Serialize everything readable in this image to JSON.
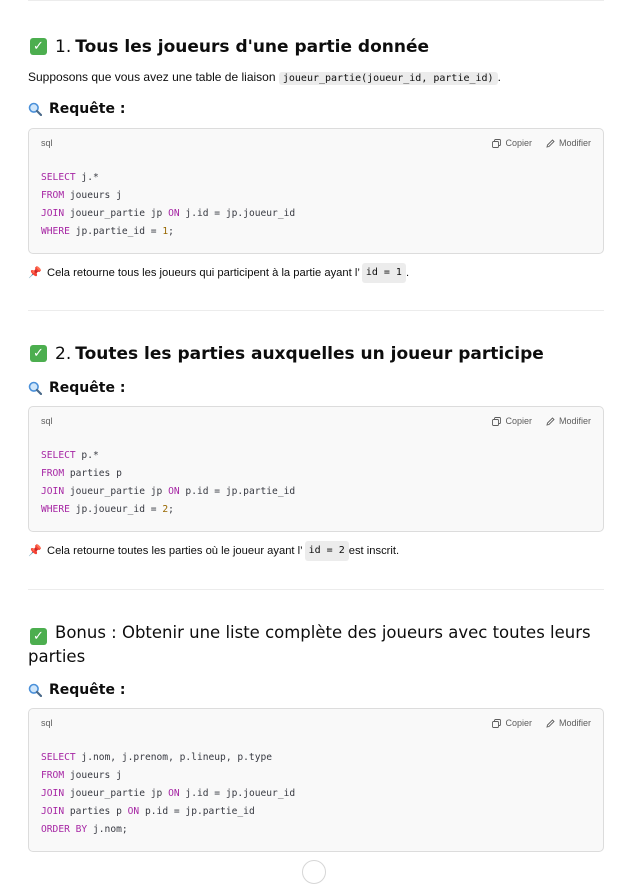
{
  "section1": {
    "number": "1.",
    "title": "Tous les joueurs d'une partie donnée",
    "intro_text": "Supposons que vous avez une table de liaison ",
    "intro_code": "joueur_partie(joueur_id, partie_id)",
    "intro_end": ".",
    "query_heading": "Requête :",
    "code_lang": "sql",
    "copy_label": "Copier",
    "edit_label": "Modifier",
    "code_lines": [
      [
        {
          "t": "SELECT",
          "k": "kw"
        },
        {
          "t": " j.*"
        }
      ],
      [
        {
          "t": "FROM",
          "k": "kw"
        },
        {
          "t": " joueurs j"
        }
      ],
      [
        {
          "t": "JOIN",
          "k": "kw"
        },
        {
          "t": " joueur_partie jp "
        },
        {
          "t": "ON",
          "k": "kw"
        },
        {
          "t": " j.id = jp.joueur_id"
        }
      ],
      [
        {
          "t": "WHERE",
          "k": "kw"
        },
        {
          "t": " jp.partie_id = "
        },
        {
          "t": "1",
          "k": "numlit"
        },
        {
          "t": ";"
        }
      ]
    ],
    "note_text": "Cela retourne tous les joueurs qui participent à la partie ayant l’",
    "note_code": "id = 1",
    "note_end": "."
  },
  "section2": {
    "number": "2.",
    "title": "Toutes les parties auxquelles un joueur participe",
    "query_heading": "Requête :",
    "code_lang": "sql",
    "copy_label": "Copier",
    "edit_label": "Modifier",
    "code_lines": [
      [
        {
          "t": "SELECT",
          "k": "kw"
        },
        {
          "t": " p.*"
        }
      ],
      [
        {
          "t": "FROM",
          "k": "kw"
        },
        {
          "t": " parties p"
        }
      ],
      [
        {
          "t": "JOIN",
          "k": "kw"
        },
        {
          "t": " joueur_partie jp "
        },
        {
          "t": "ON",
          "k": "kw"
        },
        {
          "t": " p.id = jp.partie_id"
        }
      ],
      [
        {
          "t": "WHERE",
          "k": "kw"
        },
        {
          "t": " jp.joueur_id = "
        },
        {
          "t": "2",
          "k": "numlit"
        },
        {
          "t": ";"
        }
      ]
    ],
    "note_text": "Cela retourne toutes les parties où le joueur ayant l’",
    "note_code": "id = 2",
    "note_end": " est inscrit."
  },
  "section3": {
    "title": "Bonus : Obtenir une liste complète des joueurs avec toutes leurs parties",
    "query_heading": "Requête :",
    "code_lang": "sql",
    "copy_label": "Copier",
    "edit_label": "Modifier",
    "code_lines": [
      [
        {
          "t": "SELECT",
          "k": "kw"
        },
        {
          "t": " j.nom, j.prenom, p.lineup, p.type"
        }
      ],
      [
        {
          "t": "FROM",
          "k": "kw"
        },
        {
          "t": " joueurs j"
        }
      ],
      [
        {
          "t": "JOIN",
          "k": "kw"
        },
        {
          "t": " joueur_partie jp "
        },
        {
          "t": "ON",
          "k": "kw"
        },
        {
          "t": " j.id = jp.joueur_id"
        }
      ],
      [
        {
          "t": "JOIN",
          "k": "kw"
        },
        {
          "t": " parties p "
        },
        {
          "t": "ON",
          "k": "kw"
        },
        {
          "t": " p.id = jp.partie_id"
        }
      ],
      [
        {
          "t": "ORDER BY",
          "k": "kw"
        },
        {
          "t": " j.nom;"
        }
      ]
    ]
  },
  "icons": {
    "check": "check-icon",
    "query": "magnifier-icon",
    "note": "pushpin-icon",
    "copy": "copy-icon",
    "edit": "edit-icon"
  },
  "colors": {
    "check_bg": "#4cae4f",
    "keyword": "#a626a4",
    "number": "#986801",
    "code_bg": "#f9f9f9"
  }
}
